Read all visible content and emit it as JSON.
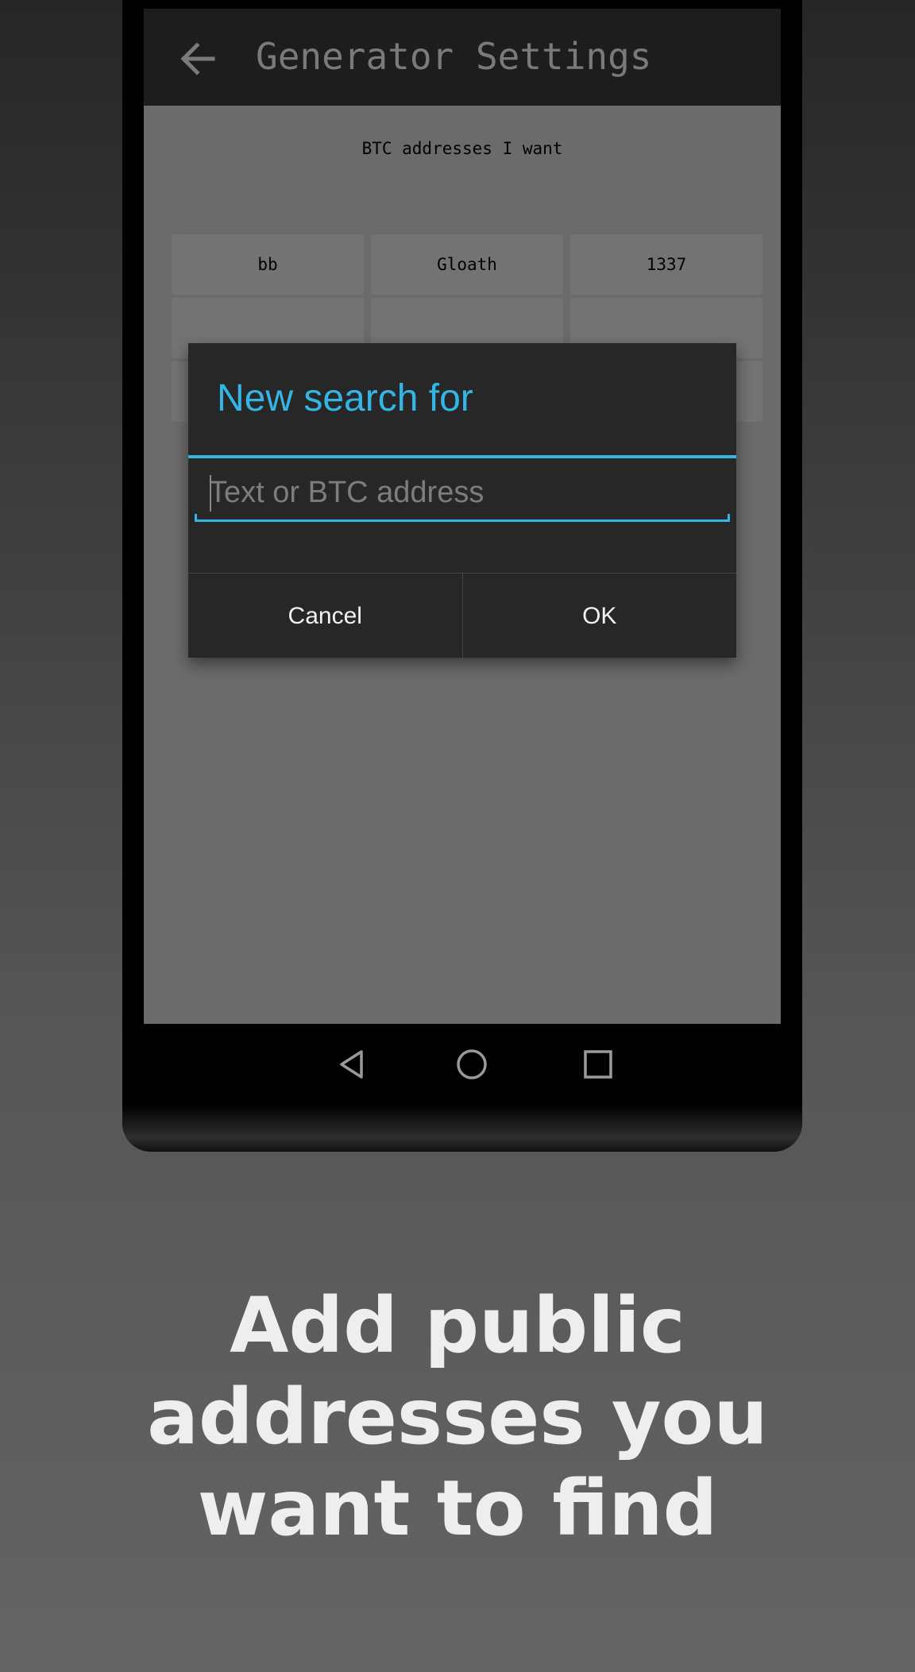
{
  "app_bar": {
    "title": "Generator Settings",
    "back_icon": "arrow-left-icon"
  },
  "settings": {
    "section_title": "BTC addresses I want",
    "address_cells": [
      "bb",
      "Gloath",
      "1337",
      "",
      "",
      "",
      "",
      "",
      ""
    ]
  },
  "dialog": {
    "title": "New search for",
    "input_placeholder": "Text or BTC address",
    "input_value": "",
    "cancel_label": "Cancel",
    "ok_label": "OK"
  },
  "nav_bar": {
    "icons": [
      "back-triangle-icon",
      "home-circle-icon",
      "recents-square-icon"
    ]
  },
  "caption": {
    "lines": [
      "Add public",
      "addresses you",
      "want to find"
    ]
  },
  "colors": {
    "accent": "#33b5e5",
    "dialog_background": "#272727",
    "app_bar_background": "#1d1d1d",
    "screen_background": "#6b6b6b",
    "caption_text": "#eeeeee"
  }
}
